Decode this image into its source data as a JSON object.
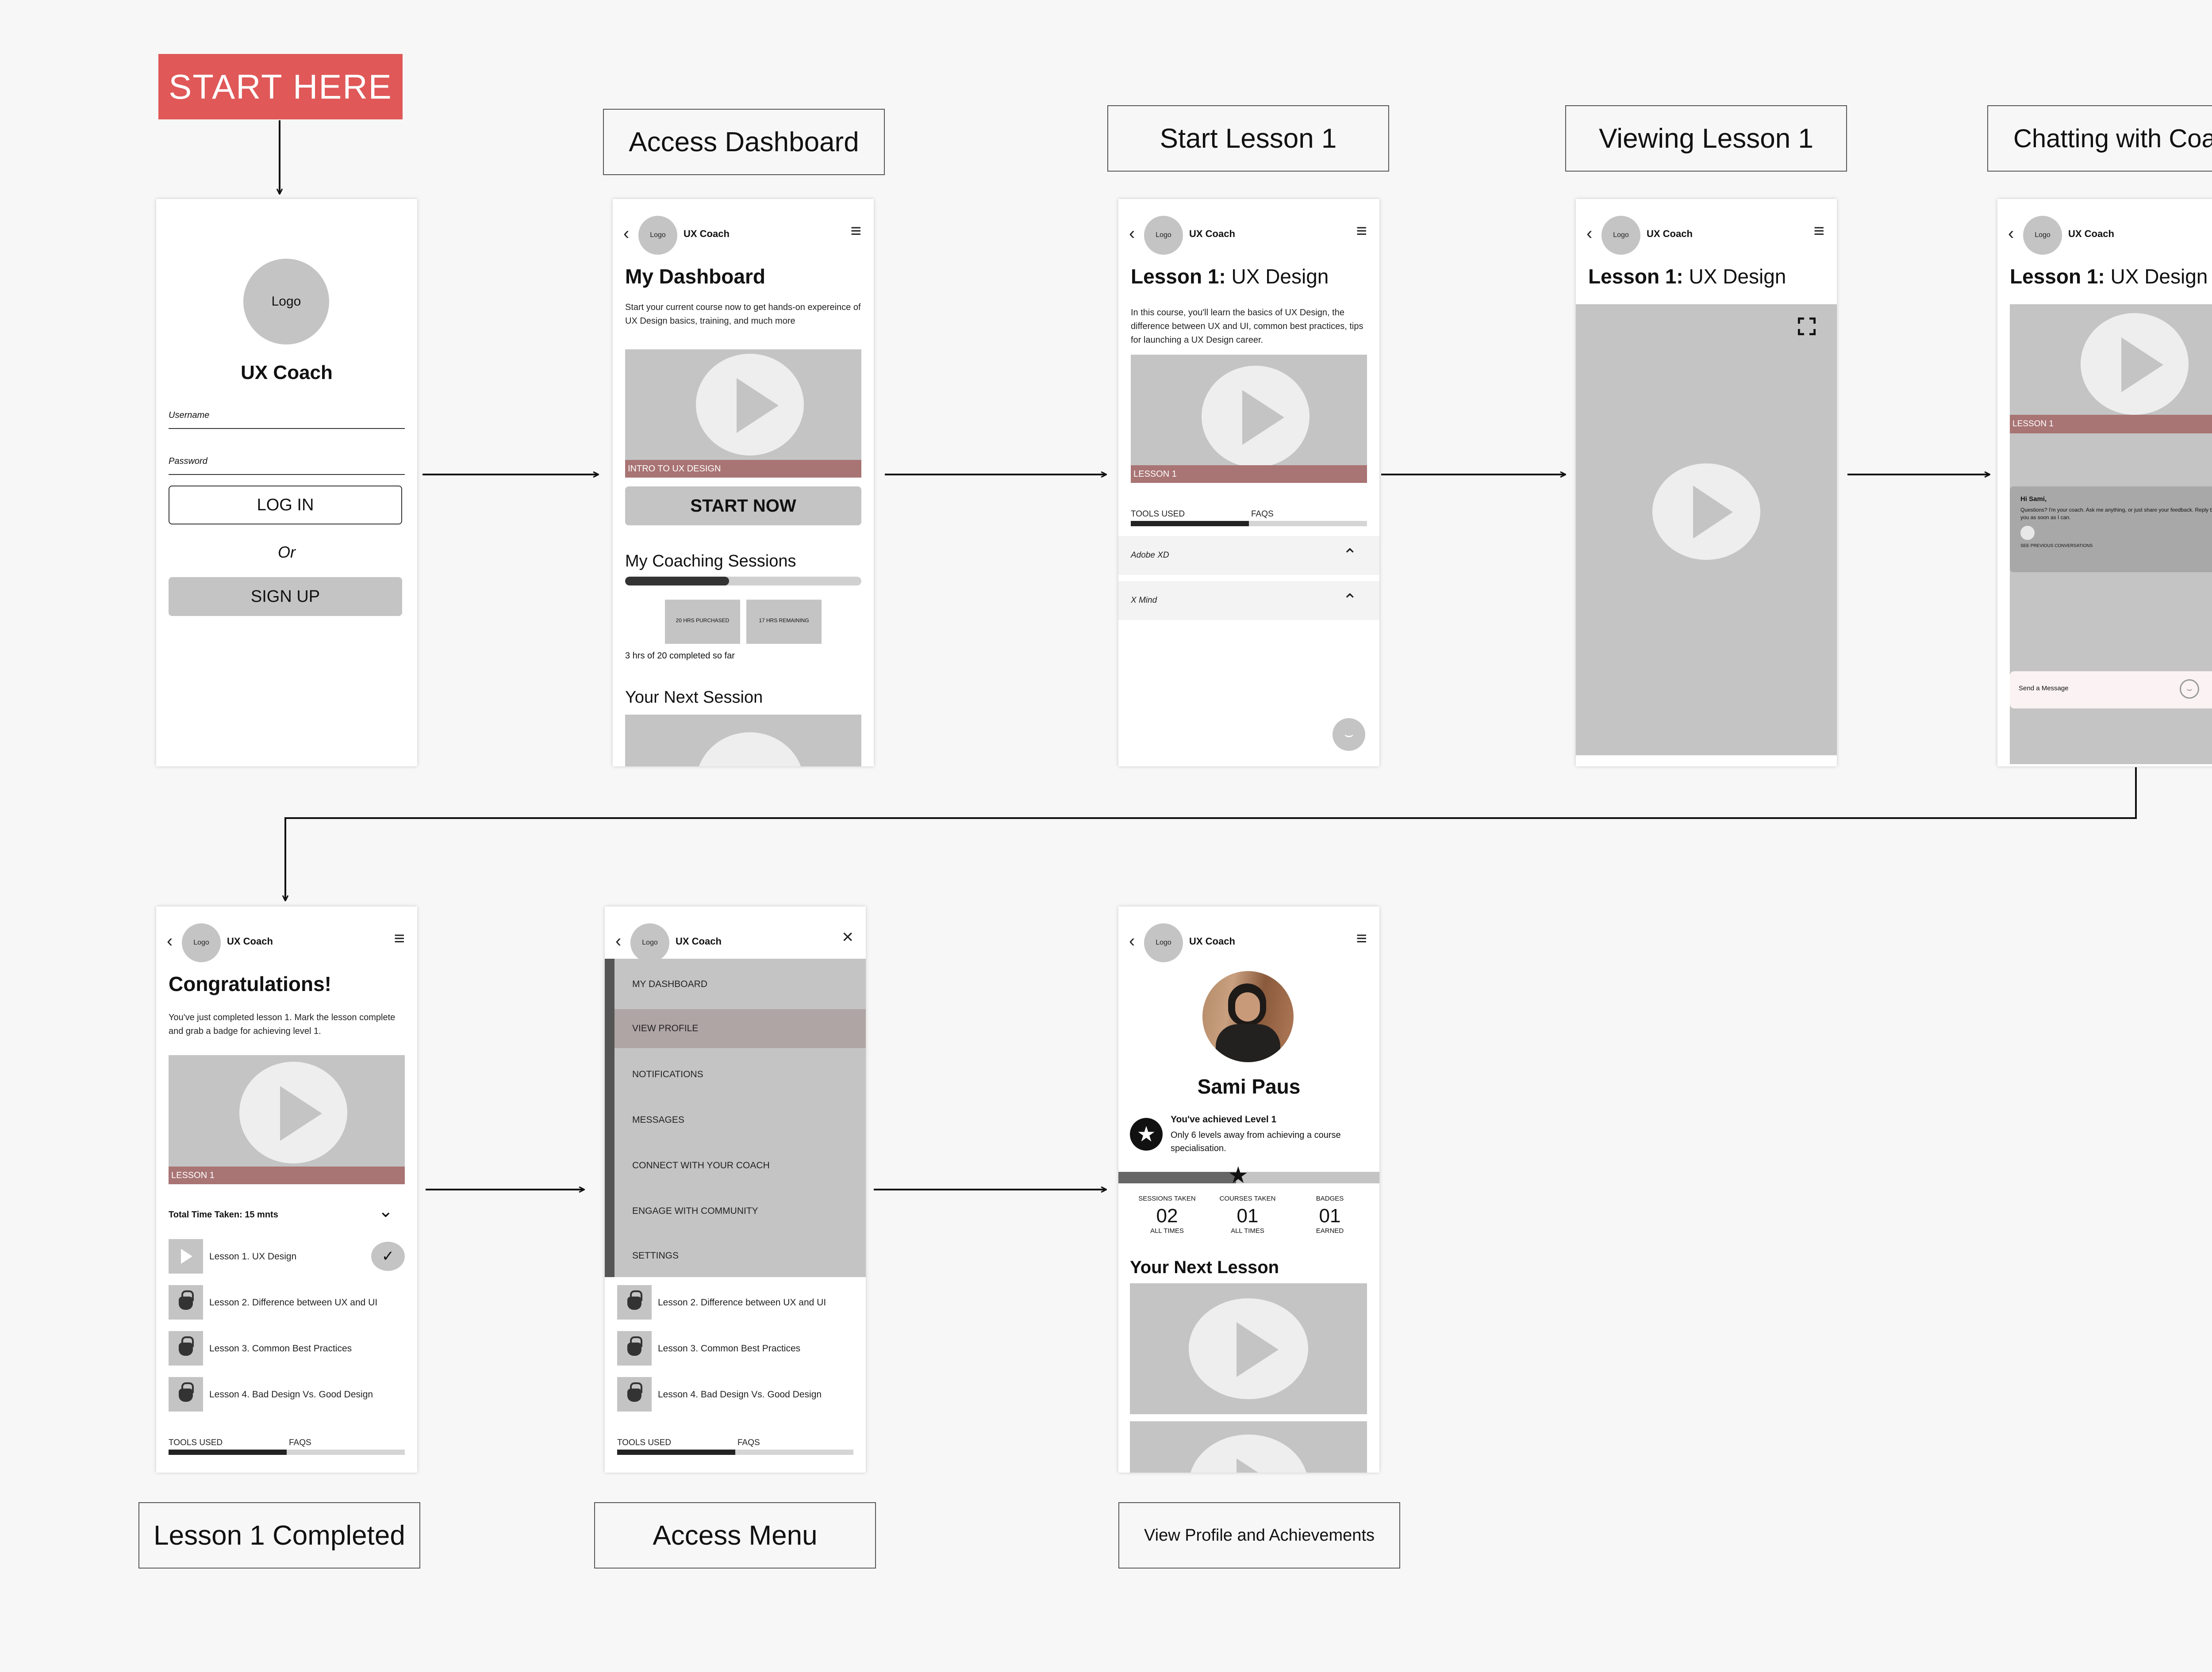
{
  "start_label": "START HERE",
  "labels": {
    "access_dashboard": "Access Dashboard",
    "start_lesson": "Start Lesson 1",
    "viewing_lesson": "Viewing Lesson 1",
    "chatting": "Chatting with Coach",
    "lesson_completed": "Lesson 1 Completed",
    "access_menu": "Access Menu",
    "view_profile": "View Profile and Achievements"
  },
  "common": {
    "logo": "Logo",
    "brand": "UX Coach",
    "lesson_title_bold": "Lesson 1:",
    "lesson_title_light": "UX Design",
    "lesson_bar": "LESSON 1",
    "tools_used": "TOOLS USED",
    "faqs": "FAQS"
  },
  "login": {
    "app_name": "UX Coach",
    "username": "Username",
    "password": "Password",
    "login": "LOG IN",
    "or": "Or",
    "signup": "SIGN UP"
  },
  "dashboard": {
    "title": "My Dashboard",
    "desc": "Start your current course now to get hands-on expereince of UX Design basics, training, and much more",
    "video_bar": "INTRO TO UX DESIGN",
    "start_now": "START NOW",
    "sessions_title": "My Coaching Sessions",
    "sessions_progress": 0.44,
    "purchased": "20 HRS PURCHASED",
    "remaining": "17 HRS REMAINING",
    "completed": "3 hrs of 20 completed so far",
    "next_session": "Your Next Session"
  },
  "lesson": {
    "desc": "In this course, you'll learn the basics of UX Design, the difference between UX and UI, common best practices, tips for launching a UX Design career.",
    "tools_progress": 0.5,
    "tools": [
      "Adobe XD",
      "X Mind"
    ]
  },
  "chat": {
    "greeting": "Hi Sami,",
    "message": "Questions? I'm your coach. Ask me anything, or just share your feedback. Reply back to you as soon as I can.",
    "previous": "SEE PREVIOUS CONVERSATIONS",
    "input_placeholder": "Send a Message"
  },
  "completed": {
    "title": "Congratulations!",
    "desc": "You've just completed lesson 1. Mark the lesson complete and grab a badge for achieving level 1.",
    "total_time": "Total Time Taken: 15 mnts",
    "lessons": [
      "Lesson 1. UX Design",
      "Lesson 2. Difference between UX and UI",
      "Lesson 3. Common Best Practices",
      "Lesson 4. Bad Design Vs. Good Design"
    ],
    "tabs_progress": 0.5
  },
  "menu": {
    "items": [
      "MY DASHBOARD",
      "VIEW PROFILE",
      "NOTIFICATIONS",
      "MESSAGES",
      "CONNECT WITH YOUR COACH",
      "ENGAGE WITH COMMUNITY",
      "SETTINGS"
    ],
    "selected": "VIEW PROFILE",
    "lessons": [
      "Lesson 2. Difference between UX and UI",
      "Lesson 3. Common Best Practices",
      "Lesson 4. Bad Design Vs. Good Design"
    ]
  },
  "profile": {
    "name": "Sami Paus",
    "achieved": "You've achieved Level 1",
    "away": "Only 6 levels away from achieving a course specialisation.",
    "level_progress": 0.45,
    "stats": [
      {
        "label": "SESSIONS TAKEN",
        "value": "02",
        "sub": "ALL TIMES"
      },
      {
        "label": "COURSES TAKEN",
        "value": "01",
        "sub": "ALL TIMES"
      },
      {
        "label": "BADGES",
        "value": "01",
        "sub": "EARNED"
      }
    ],
    "next_lesson": "Your Next Lesson"
  },
  "colors": {
    "accent": "#e05858",
    "video_bar": "#a97474",
    "placeholder": "#c4c4c4"
  }
}
